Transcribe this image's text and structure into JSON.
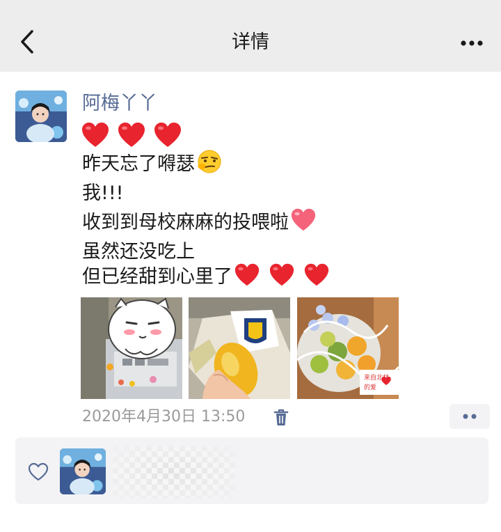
{
  "header": {
    "title": "详情",
    "back_icon": "chevron-left-icon",
    "more_icon": "more-dots-icon"
  },
  "post": {
    "username": "阿梅丫丫",
    "lines": [
      "昨天忘了嘚瑟",
      "我!!!",
      "收到到母校麻麻的投喂啦",
      "虽然还没吃上",
      "但已经甜到心里了"
    ],
    "photos": [
      "sticker-photo",
      "mango-hand-photo",
      "mango-box-photo"
    ],
    "photo_caption": "来自北林的爱",
    "timestamp": "2020年4月30日 13:50"
  },
  "colors": {
    "name": "#576b95",
    "heart_red": "#e8242e",
    "header_bg": "#ededed",
    "likes_bg": "#f3f3f5"
  }
}
